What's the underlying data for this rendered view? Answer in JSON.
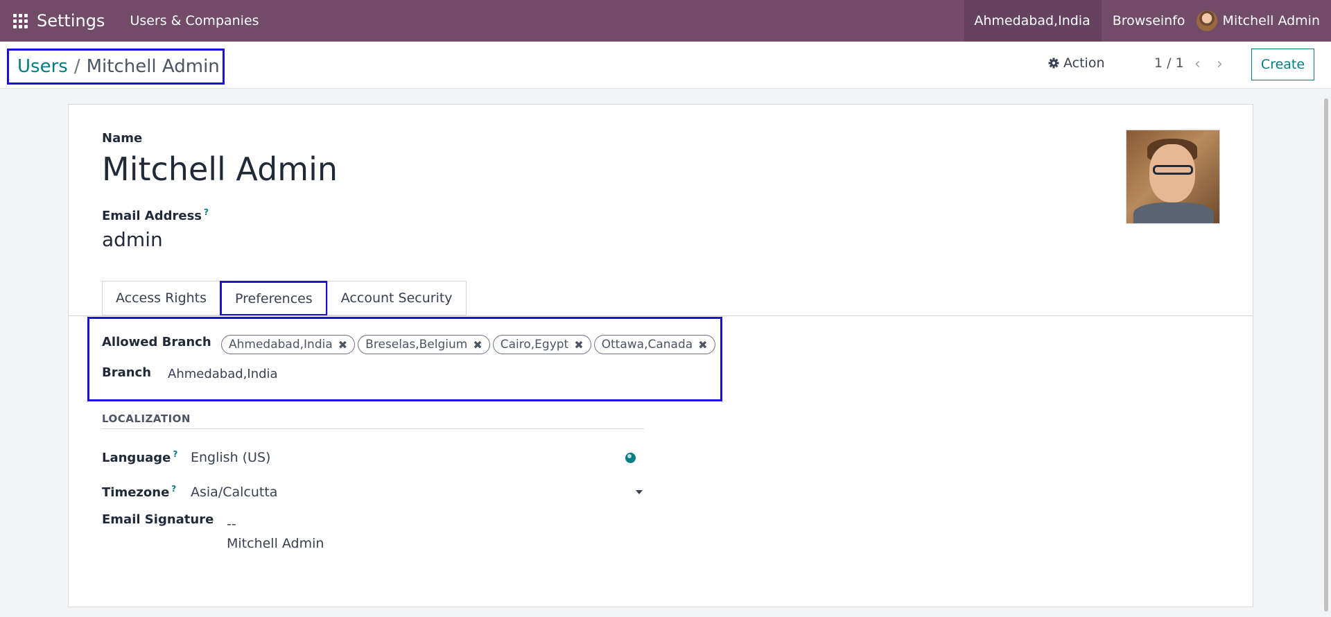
{
  "navbar": {
    "app_title": "Settings",
    "menu_item": "Users & Companies",
    "company": "Ahmedabad,India",
    "link": "Browseinfo",
    "user_name": "Mitchell Admin"
  },
  "control_panel": {
    "breadcrumb_parent": "Users",
    "breadcrumb_separator": "/",
    "breadcrumb_current": "Mitchell Admin",
    "action_label": "Action",
    "pager": "1 / 1",
    "create_label": "Create"
  },
  "form": {
    "name_label": "Name",
    "name_value": "Mitchell Admin",
    "email_label": "Email Address",
    "email_help": "?",
    "email_value": "admin",
    "tabs": [
      "Access Rights",
      "Preferences",
      "Account Security"
    ],
    "active_tab": "Preferences",
    "allowed_branch_label": "Allowed Branch",
    "allowed_branches": [
      "Ahmedabad,India",
      "Breselas,Belgium",
      "Cairo,Egypt",
      "Ottawa,Canada"
    ],
    "branch_label": "Branch",
    "branch_value": "Ahmedabad,India",
    "localization_title": "LOCALIZATION",
    "language_label": "Language",
    "language_help": "?",
    "language_value": "English (US)",
    "timezone_label": "Timezone",
    "timezone_help": "?",
    "timezone_value": "Asia/Calcutta",
    "signature_label": "Email Signature",
    "signature_line1": "--",
    "signature_line2": "Mitchell Admin"
  },
  "colors": {
    "navbar": "#714b67",
    "accent": "#017e84",
    "highlight_box": "#1c0fd6"
  }
}
